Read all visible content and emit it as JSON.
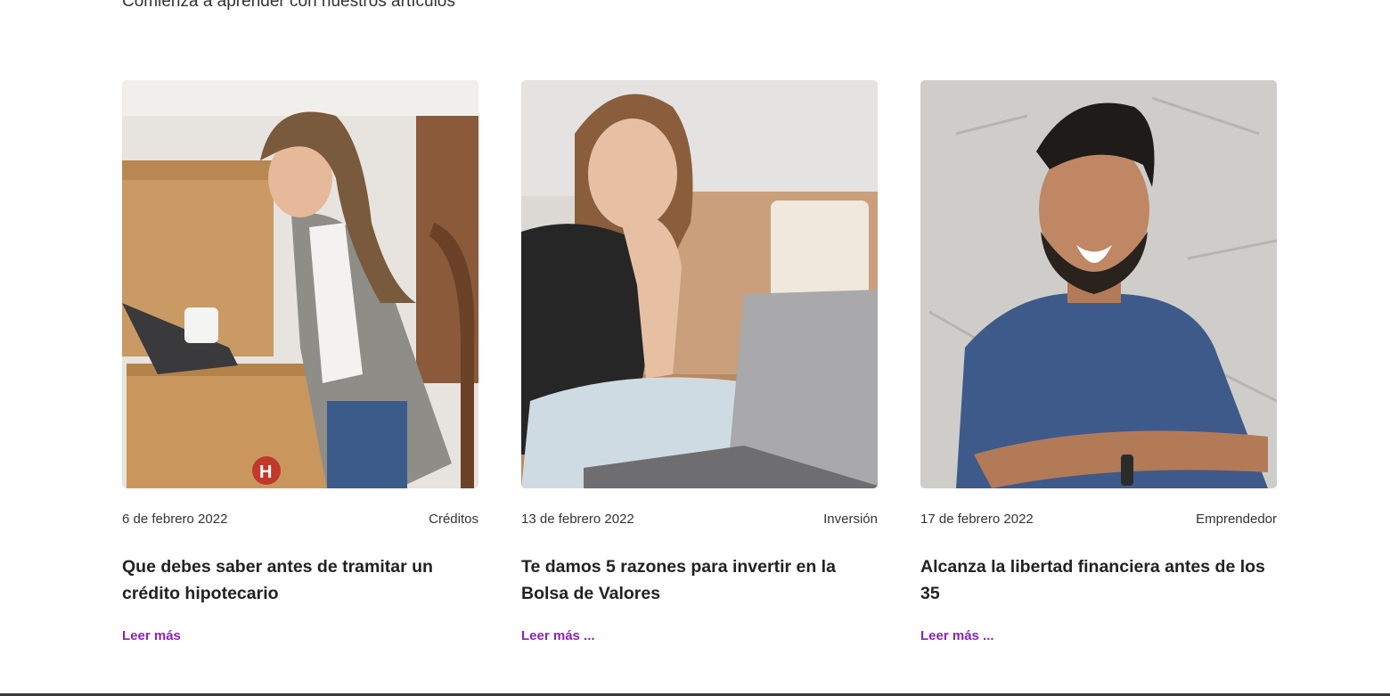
{
  "section": {
    "subtitle": "Comienza a aprender con nuestros artículos"
  },
  "articles": [
    {
      "date": "6 de febrero 2022",
      "category": "Créditos",
      "title": "Que debes saber antes de tramitar un crédito hipotecario",
      "read_more": "Leer más",
      "image": "woman-with-laptop-and-moving-boxes"
    },
    {
      "date": "13 de febrero 2022",
      "category": "Inversión",
      "title": "Te damos 5 razones para invertir en la Bolsa de Valores",
      "read_more": "Leer más ...",
      "image": "woman-resting-chin-on-hand-with-laptop"
    },
    {
      "date": "17 de febrero 2022",
      "category": "Emprendedor",
      "title": "Alcanza la libertad financiera antes de los 35",
      "read_more": "Leer más ...",
      "image": "smiling-man-arms-crossed"
    }
  ],
  "colors": {
    "link": "#8a24b7",
    "text": "#222222"
  }
}
